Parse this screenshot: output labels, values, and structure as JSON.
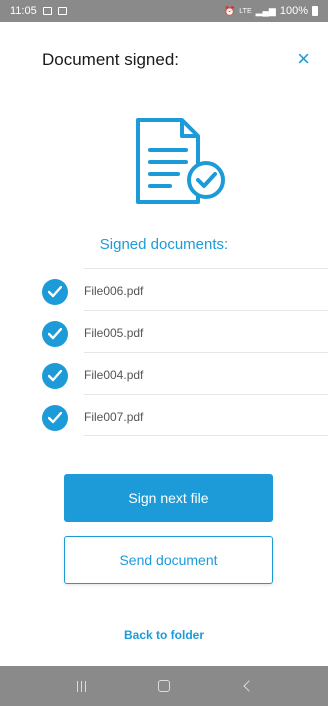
{
  "status_bar": {
    "time": "11:05",
    "battery_text": "100%",
    "icons": [
      "gallery-icon",
      "clipboard-icon",
      "alarm-icon",
      "lte-signal-icon",
      "signal-icon",
      "battery-icon"
    ]
  },
  "header": {
    "title": "Document signed:",
    "close_icon": "×"
  },
  "illustration": {
    "icon": "signed-document-icon"
  },
  "section_title": "Signed documents:",
  "files": [
    {
      "name": "File006.pdf",
      "icon": "check-circle-icon"
    },
    {
      "name": "File005.pdf",
      "icon": "check-circle-icon"
    },
    {
      "name": "File004.pdf",
      "icon": "check-circle-icon"
    },
    {
      "name": "File007.pdf",
      "icon": "check-circle-icon"
    }
  ],
  "buttons": {
    "primary_label": "Sign next file",
    "secondary_label": "Send document"
  },
  "back_link": "Back to folder",
  "nav_bar": {
    "icons": [
      "recent-apps-icon",
      "home-icon",
      "back-icon"
    ]
  },
  "colors": {
    "accent": "#1d9bd8",
    "status_bar": "#8a8a8a",
    "text": "#1a1a1a",
    "file_text": "#555555"
  }
}
